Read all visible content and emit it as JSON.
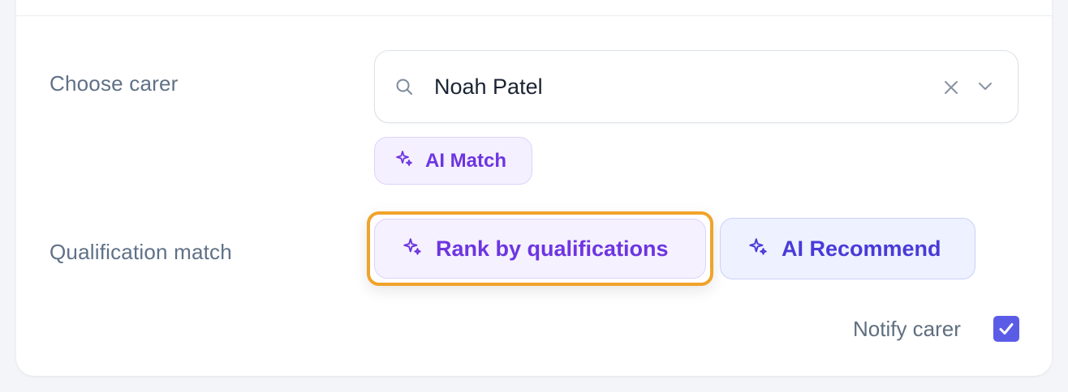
{
  "carer": {
    "label": "Choose carer",
    "selected_value": "Noah Patel",
    "search_icon": "search-icon",
    "clear_icon": "close-icon",
    "dropdown_icon": "chevron-down-icon"
  },
  "ai_match": {
    "label": "AI Match",
    "icon": "sparkles-icon",
    "color": "#6d35e0"
  },
  "qualification": {
    "label": "Qualification match",
    "rank_button_label": "Rank by qualifications",
    "rank_button_highlight": "#f0a32a",
    "recommend_button_label": "AI Recommend",
    "recommend_color": "#4a3ad8"
  },
  "notify": {
    "label": "Notify carer",
    "checked": true,
    "checkbox_color": "#5b5ce6"
  }
}
